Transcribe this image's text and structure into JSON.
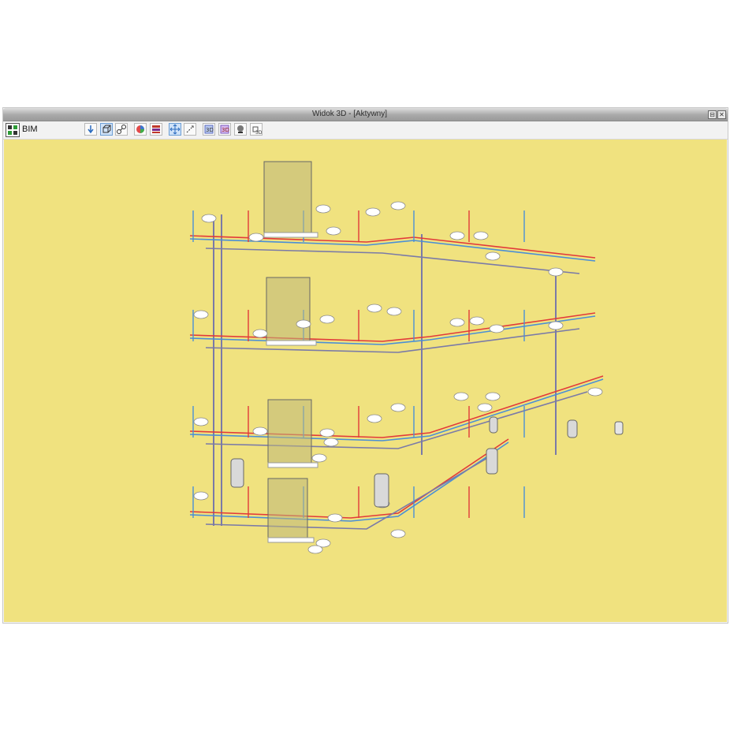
{
  "window": {
    "title": "Widok 3D - [Aktywny]",
    "restore_glyph": "⊟",
    "close_glyph": "✕"
  },
  "toolbar": {
    "label": "BIM",
    "icons": [
      "bim-mode-icon",
      "view-orient-icon",
      "cube-view-icon",
      "link-icon",
      "color-wheel-icon",
      "layers-icon",
      "pan-icon",
      "rotate-icon",
      "zoom-icon",
      "section-icon",
      "render-icon",
      "3d-icon"
    ]
  },
  "viewport": {
    "background": "#f0e27f",
    "colors": {
      "hot_water": "#e23a3a",
      "cold_water": "#4a8fd6",
      "drain": "#7a7aa8",
      "fixtures": "#ffffff",
      "shower_glass": "#bdb67a"
    }
  }
}
